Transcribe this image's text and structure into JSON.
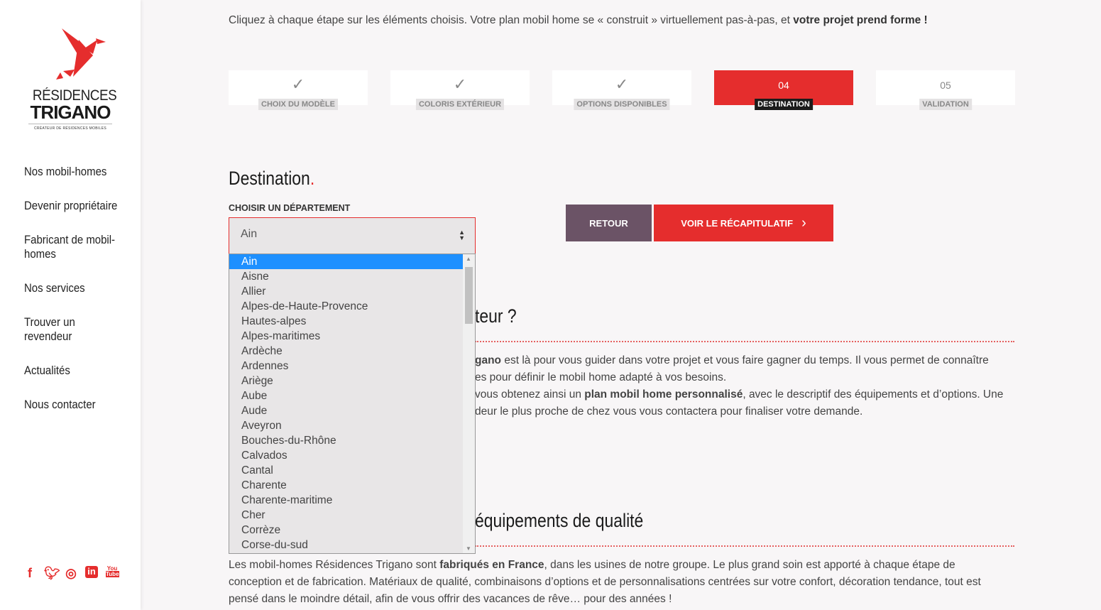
{
  "logo": {
    "line1": "RÉSIDENCES",
    "line2": "TRIGANO",
    "tagline": "CRÉATEUR DE RÉSIDENCES MOBILES"
  },
  "nav": [
    "Nos mobil-homes",
    "Devenir propriétaire",
    "Fabricant de mobil-homes",
    "Nos services",
    "Trouver un revendeur",
    "Actualités",
    "Nous contacter"
  ],
  "social": [
    "facebook-icon",
    "twitter-icon",
    "instagram-icon",
    "linkedin-icon",
    "youtube-icon"
  ],
  "intro": {
    "text": "Cliquez à chaque étape sur les éléments choisis. Votre plan mobil home se « construit » virtuellement pas-à-pas, et ",
    "bold": "votre projet prend forme !"
  },
  "steps": [
    {
      "label": "CHOIX DU MODÈLE",
      "state": "done",
      "mark": "✓"
    },
    {
      "label": "COLORIS EXTÉRIEUR",
      "state": "done",
      "mark": "✓"
    },
    {
      "label": "OPTIONS DISPONIBLES",
      "state": "done",
      "mark": "✓"
    },
    {
      "label": "DESTINATION",
      "state": "active",
      "mark": "04"
    },
    {
      "label": "VALIDATION",
      "state": "todo",
      "mark": "05"
    }
  ],
  "destination": {
    "title": "Destination",
    "dot": ".",
    "field_label": "CHOISIR UN DÉPARTEMENT",
    "selected": "Ain",
    "options": [
      "Ain",
      "Aisne",
      "Allier",
      "Alpes-de-Haute-Provence",
      "Hautes-alpes",
      "Alpes-maritimes",
      "Ardèche",
      "Ardennes",
      "Ariège",
      "Aube",
      "Aude",
      "Aveyron",
      "Bouches-du-Rhône",
      "Calvados",
      "Cantal",
      "Charente",
      "Charente-maritime",
      "Cher",
      "Corrèze",
      "Corse-du-sud"
    ]
  },
  "buttons": {
    "back": "RETOUR",
    "summary": "VOIR LE RÉCAPITULATIF"
  },
  "section1": {
    "title_fragment": "teur ?",
    "p1a": "gano",
    "p1b": " est là pour vous guider dans votre projet et vous faire gagner du temps. Il vous permet de connaître",
    "p2": "es pour définir le mobil home adapté à vos besoins.",
    "p3a": "vous obtenez ainsi un ",
    "p3b": "plan mobil home personnalisé",
    "p3c": ", avec le descriptif des équipements et d’options. Une",
    "p4": "deur le plus proche de chez vous vous contactera pour finaliser votre demande."
  },
  "section2": {
    "title_fragment": "équipements de qualité",
    "l1a": "Les mobil-homes Résidences Trigano sont ",
    "l1b": "fabriqués en France",
    "l1c": ", dans les usines de notre groupe. Le plus grand soin est apporté à chaque étape de",
    "l2": "conception et de fabrication. Matériaux de qualité, combinaisons d’options et de personnalisations centrées sur votre confort, décoration tendance, tout est",
    "l3": "pensé dans le moindre détail, afin de vous offrir des vacances de rêve… pour des années !"
  },
  "colors": {
    "accent": "#e52d2d",
    "back_button": "#6b5366",
    "selected_option": "#1e90ff"
  }
}
